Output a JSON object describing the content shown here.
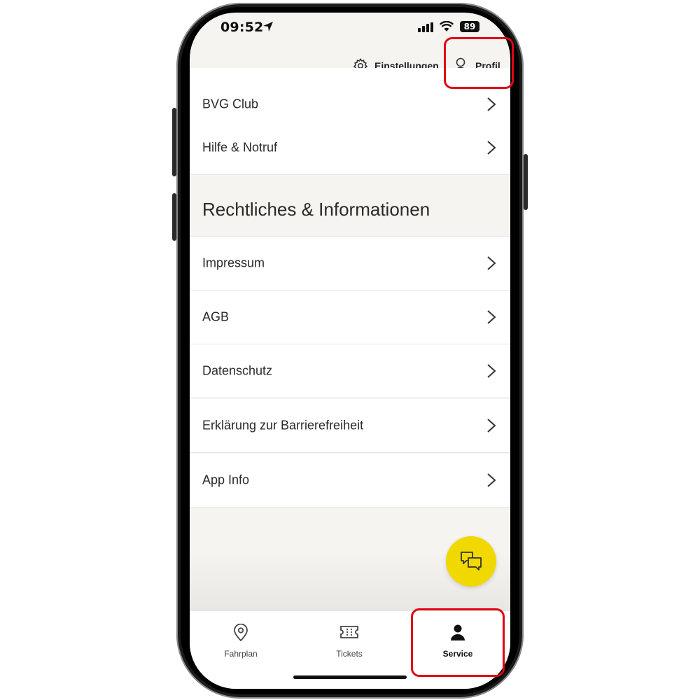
{
  "status_bar": {
    "time": "09:52",
    "battery": "89"
  },
  "header": {
    "settings_label": "Einstellungen",
    "profile_label": "Profil"
  },
  "menu_top": [
    {
      "label": "BVG Club"
    },
    {
      "label": "Hilfe & Notruf"
    }
  ],
  "section": {
    "title": "Rechtliches & Informationen",
    "items": [
      {
        "label": "Impressum"
      },
      {
        "label": "AGB"
      },
      {
        "label": "Datenschutz"
      },
      {
        "label": "Erklärung zur Barrierefreiheit"
      },
      {
        "label": "App Info"
      }
    ]
  },
  "fab": {
    "icon": "chat-bubbles-icon"
  },
  "tabbar": {
    "tabs": [
      {
        "label": "Fahrplan",
        "icon": "map-pin-icon"
      },
      {
        "label": "Tickets",
        "icon": "ticket-icon"
      },
      {
        "label": "Service",
        "icon": "person-icon",
        "active": true
      }
    ]
  },
  "colors": {
    "accent_yellow": "#f0d800",
    "highlight_red": "#e10514",
    "background": "#f5f4f0"
  }
}
